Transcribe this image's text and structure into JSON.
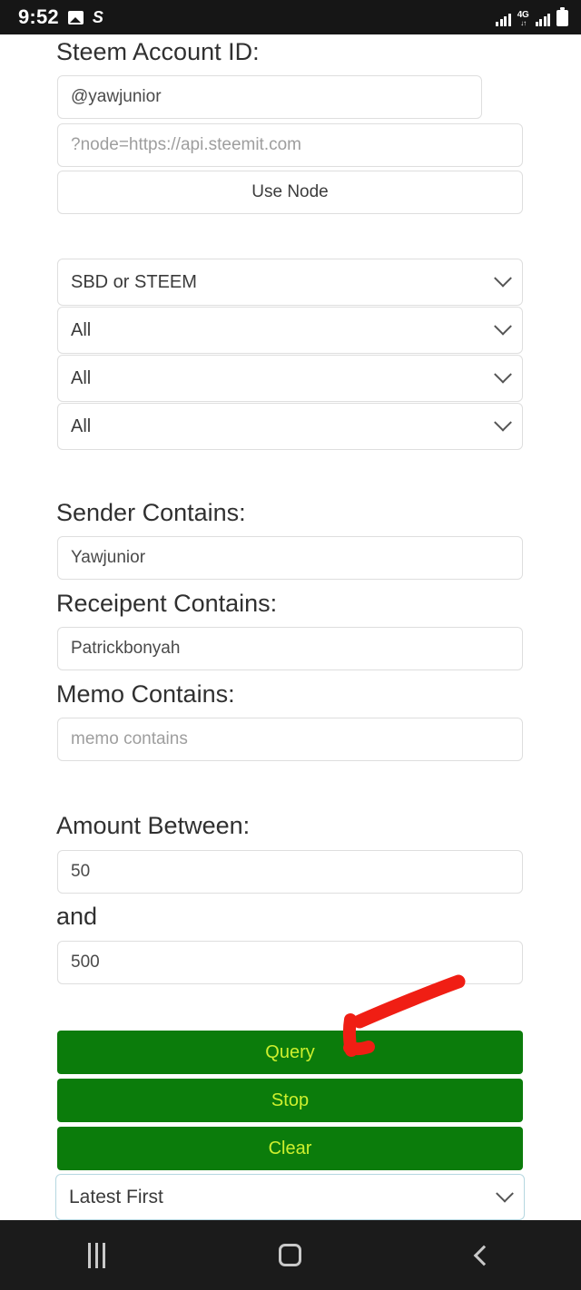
{
  "status_bar": {
    "time": "9:52",
    "icons_left": [
      "photo-icon",
      "steem-icon"
    ],
    "icons_right": [
      "signal-icon",
      "4g-icon",
      "signal-icon",
      "battery-icon"
    ],
    "network": "4G",
    "data_arrows": "↓↑"
  },
  "form": {
    "account_label": "Steem Account ID:",
    "account_value": "@yawjunior",
    "node_placeholder": "?node=https://api.steemit.com",
    "use_node_label": "Use Node",
    "selects": [
      {
        "name": "currency",
        "value": "SBD or STEEM"
      },
      {
        "name": "filter-2",
        "value": "All"
      },
      {
        "name": "filter-3",
        "value": "All"
      },
      {
        "name": "filter-4",
        "value": "All"
      }
    ],
    "sender_label": "Sender Contains:",
    "sender_value": "Yawjunior",
    "recipient_label": "Receipent Contains:",
    "recipient_value": "Patrickbonyah",
    "memo_label": "Memo Contains:",
    "memo_placeholder": "memo contains",
    "amount_label": "Amount Between:",
    "amount_min": "50",
    "amount_and_label": "and",
    "amount_max": "500",
    "query_label": "Query",
    "stop_label": "Stop",
    "clear_label": "Clear",
    "sort_value": "Latest First"
  },
  "annotation": {
    "type": "red-arrow",
    "points_at": "query-button",
    "color": "#f01e14"
  },
  "colors": {
    "button_green": "#0b7c0b",
    "button_text": "#cdf02e",
    "status_bar": "#161616",
    "nav_bar": "#1b1b1b",
    "field_border": "#dedede",
    "focus_border": "#b5d7e0"
  },
  "nav_bar": {
    "recents": "recents-icon",
    "home": "home-icon",
    "back": "back-icon"
  }
}
